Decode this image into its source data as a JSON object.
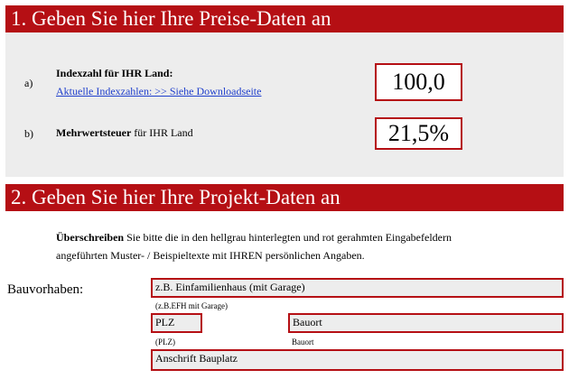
{
  "section1": {
    "title": "1. Geben Sie hier Ihre Preise-Daten an",
    "row_a": {
      "letter": "a)",
      "label": "Indexzahl für IHR Land:",
      "link": "Aktuelle Indexzahlen: >> Siehe Downloadseite",
      "value": "100,0"
    },
    "row_b": {
      "letter": "b)",
      "label_bold": "Mehrwertsteuer",
      "label_rest": " für IHR Land",
      "value": "21,5%"
    }
  },
  "section2": {
    "title": "2. Geben Sie hier Ihre Projekt-Daten an",
    "instructions": {
      "bold": "Überschreiben",
      "line1_rest": " Sie bitte die in den hellgrau hinterlegten und rot gerahmten Eingabefeldern",
      "line2": "angeführten Muster- / Beispieltexte mit IHREN persönlichen Angaben."
    },
    "bauvorhaben_label": "Bauvorhaben:",
    "project_field": {
      "value": "z.B. Einfamilienhaus (mit Garage)",
      "hint": "(z.B.EFH mit Garage)"
    },
    "plz_field": {
      "value": "PLZ",
      "hint": "(PLZ)"
    },
    "bauort_field": {
      "value": "Bauort",
      "hint": "Bauort"
    },
    "address_field": {
      "value": "Anschrift Bauplatz"
    }
  },
  "colors": {
    "accent": "#b50f14",
    "input_bg": "#ededed",
    "link": "#1f3fcc"
  }
}
